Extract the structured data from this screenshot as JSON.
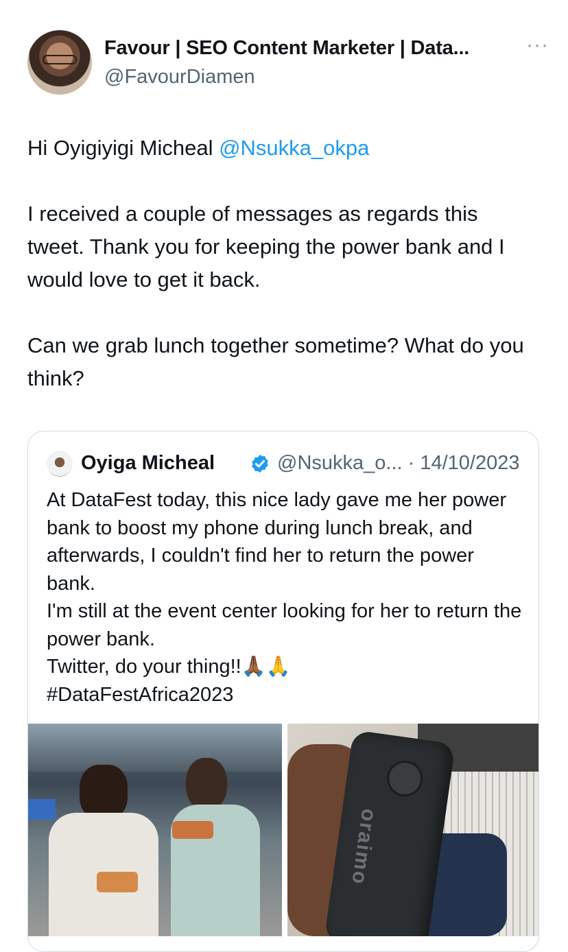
{
  "tweet": {
    "author": {
      "name": "Favour | SEO Content Marketer | Data...",
      "handle": "@FavourDiamen"
    },
    "more_label": "···",
    "greeting_prefix": "Hi Oyigiyigi Micheal ",
    "greeting_mention": "@Nsukka_okpa",
    "paragraph2": "I received a couple of messages as regards this tweet. Thank you for keeping the power bank and I would love to get it back.",
    "paragraph3": "Can we grab lunch together sometime? What do you think?"
  },
  "quoted_tweet": {
    "author_name": "Oyiga Micheal",
    "handle_date": "@Nsukka_o... · 14/10/2023",
    "lines": [
      "At DataFest today, this nice lady gave me her power bank to boost my phone during lunch break, and afterwards, I couldn't find her to return the power bank.",
      "I'm still at the event center looking for her to return the power bank.",
      "Twitter, do your thing!!🙏🏾🙏",
      "#DataFestAfrica2023"
    ],
    "photo_brand_text": "oraimo"
  },
  "colors": {
    "link": "#1d9bf0",
    "secondary_text": "#536471",
    "border": "#cfd9de",
    "verified": "#1d9bf0"
  }
}
